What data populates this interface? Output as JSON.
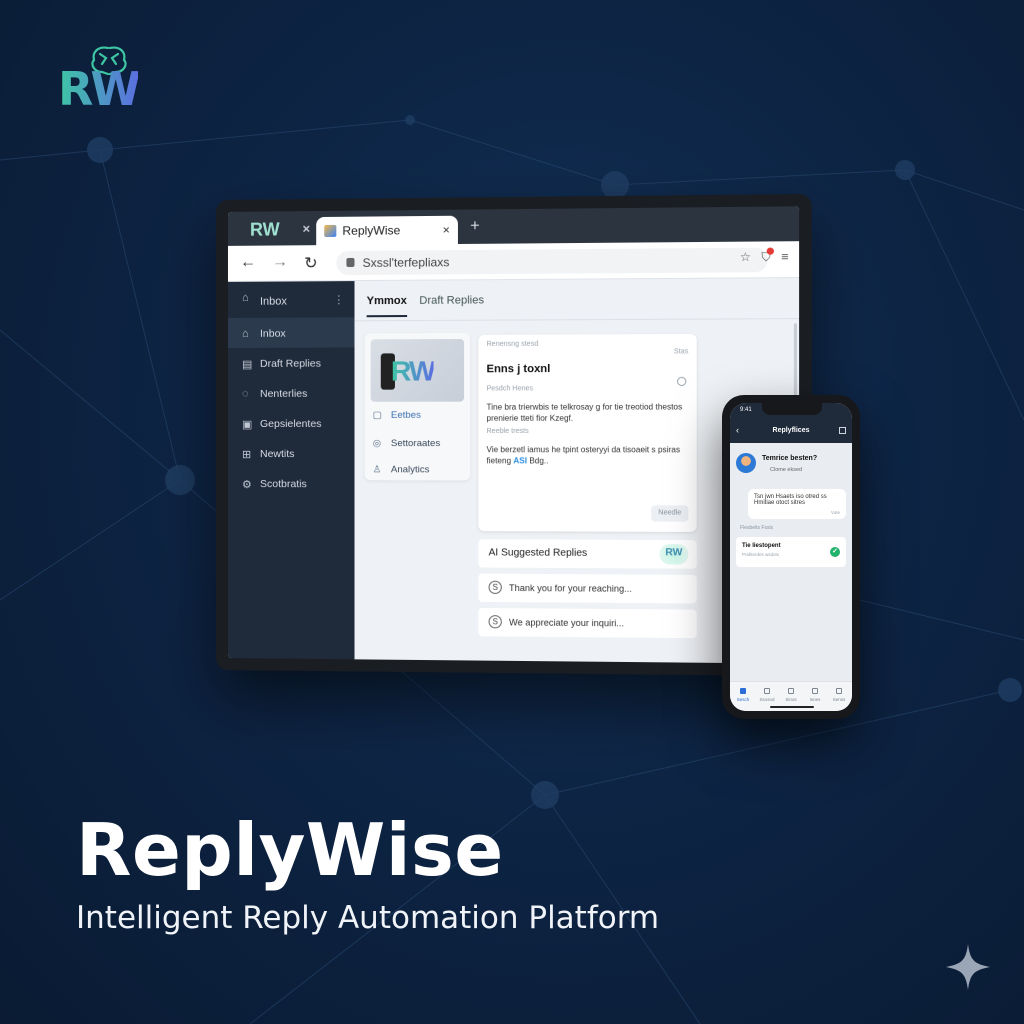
{
  "brand": {
    "logo_text": "RW",
    "name": "ReplyWise",
    "tagline": "Intelligent Reply Automation Platform",
    "accent_colors": [
      "#3ec7a4",
      "#5b6fe0"
    ]
  },
  "browser": {
    "tab_logo": "RW",
    "tab_title": "ReplyWise",
    "close_icon": "×",
    "new_tab_icon": "+",
    "url": "Sxssl'terfepliaxs"
  },
  "sidebar": {
    "items": [
      {
        "label": "Inbox",
        "icon": "home-icon"
      },
      {
        "label": "Inbox",
        "icon": "home-icon"
      },
      {
        "label": "Draft Replies",
        "icon": "draft-icon"
      },
      {
        "label": "Nenterlies",
        "icon": "chat-icon"
      },
      {
        "label": "Gepsielentes",
        "icon": "list-icon"
      },
      {
        "label": "Newtits",
        "icon": "grid-icon"
      },
      {
        "label": "Scotbratis",
        "icon": "settings-icon"
      }
    ]
  },
  "main": {
    "tabs": [
      {
        "label": "Ymmox"
      },
      {
        "label": "Draft Replies"
      }
    ],
    "left_card": {
      "logo": "RW",
      "items": [
        {
          "label": "Eetbes"
        },
        {
          "label": "Settoraates"
        },
        {
          "label": "Analytics"
        }
      ]
    },
    "email": {
      "meta": "Renensng stesd",
      "meta_right": "Stas",
      "subject": "Enns j toxnl",
      "from": "Pesdch Henes",
      "body1": "Tine bra trierwbis te telkrosay g for tie treotiod thestos prenierie tteti fior Kzegf.",
      "label2": "Reeble trests",
      "body2_prefix": "Vie berzetl iamus he tpint osteryyi da tisoaeit s psiras fieteng ",
      "body2_highlight": "ASI",
      "body2_suffix": " Bdg..",
      "button": "Needle"
    },
    "suggestions": {
      "header": "AI Suggested Replies",
      "badge": "RW",
      "replies": [
        "Thank you for your reaching...",
        "We appreciate your inquiri..."
      ]
    }
  },
  "phone": {
    "time": "9:41",
    "title": "Replyflices",
    "contact_name": "Temrice besten?",
    "contact_sub": "Clome eksed",
    "bubble_text": "Tsn jwn Hsaets iso otred ss Hmitiae otoct sitres",
    "bubble_time": "Vote",
    "label": "Flesbeits Fssis",
    "card_title": "Tie liestopent",
    "card_sub": "Prafiterdes wsdots",
    "nav": [
      "Sesch",
      "Ssosnd",
      "Sinos",
      "Isnes",
      "Senss"
    ]
  }
}
